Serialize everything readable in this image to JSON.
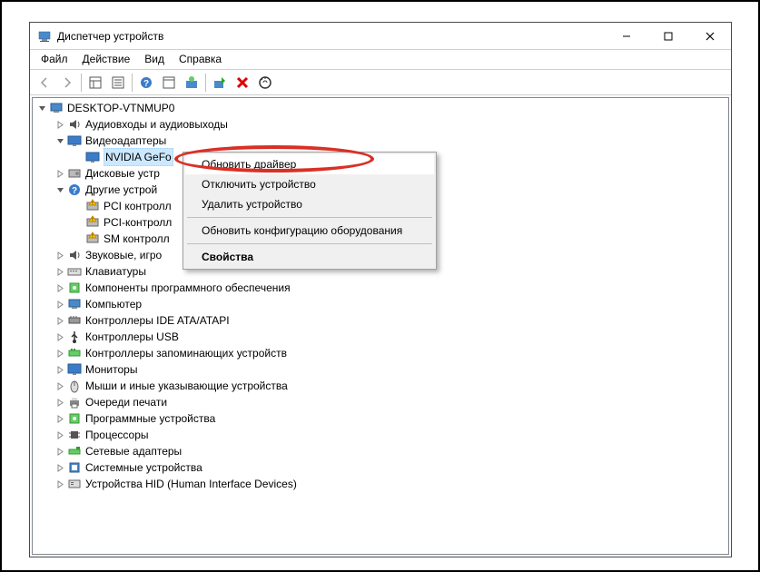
{
  "window": {
    "title": "Диспетчер устройств"
  },
  "menu": {
    "file": "Файл",
    "action": "Действие",
    "view": "Вид",
    "help": "Справка"
  },
  "tree": {
    "root": "DESKTOP-VTNMUP0",
    "nodes": [
      {
        "label": "Аудиовходы и аудиовыходы",
        "expanded": false,
        "icon": "audio"
      },
      {
        "label": "Видеоадаптеры",
        "expanded": true,
        "icon": "display",
        "children": [
          {
            "label": "NVIDIA GeFo",
            "icon": "display",
            "selected": true
          }
        ]
      },
      {
        "label": "Дисковые устр",
        "expanded": false,
        "icon": "disk"
      },
      {
        "label": "Другие устрой",
        "expanded": true,
        "icon": "other",
        "children": [
          {
            "label": "PCI контролл",
            "icon": "warning"
          },
          {
            "label": "PCI-контролл",
            "icon": "warning"
          },
          {
            "label": "SM контролл",
            "icon": "warning"
          }
        ]
      },
      {
        "label": "Звуковые, игро",
        "expanded": false,
        "icon": "audio"
      },
      {
        "label": "Клавиатуры",
        "expanded": false,
        "icon": "keyboard"
      },
      {
        "label": "Компоненты программного обеспечения",
        "expanded": false,
        "icon": "software"
      },
      {
        "label": "Компьютер",
        "expanded": false,
        "icon": "computer"
      },
      {
        "label": "Контроллеры IDE ATA/ATAPI",
        "expanded": false,
        "icon": "ide"
      },
      {
        "label": "Контроллеры USB",
        "expanded": false,
        "icon": "usb"
      },
      {
        "label": "Контроллеры запоминающих устройств",
        "expanded": false,
        "icon": "storage"
      },
      {
        "label": "Мониторы",
        "expanded": false,
        "icon": "monitor"
      },
      {
        "label": "Мыши и иные указывающие устройства",
        "expanded": false,
        "icon": "mouse"
      },
      {
        "label": "Очереди печати",
        "expanded": false,
        "icon": "printer"
      },
      {
        "label": "Программные устройства",
        "expanded": false,
        "icon": "software"
      },
      {
        "label": "Процессоры",
        "expanded": false,
        "icon": "cpu"
      },
      {
        "label": "Сетевые адаптеры",
        "expanded": false,
        "icon": "network"
      },
      {
        "label": "Системные устройства",
        "expanded": false,
        "icon": "system"
      },
      {
        "label": "Устройства HID (Human Interface Devices)",
        "expanded": false,
        "icon": "hid"
      }
    ]
  },
  "context_menu": {
    "update_driver": "Обновить драйвер",
    "disable_device": "Отключить устройство",
    "uninstall_device": "Удалить устройство",
    "scan_hardware": "Обновить конфигурацию оборудования",
    "properties": "Свойства"
  }
}
